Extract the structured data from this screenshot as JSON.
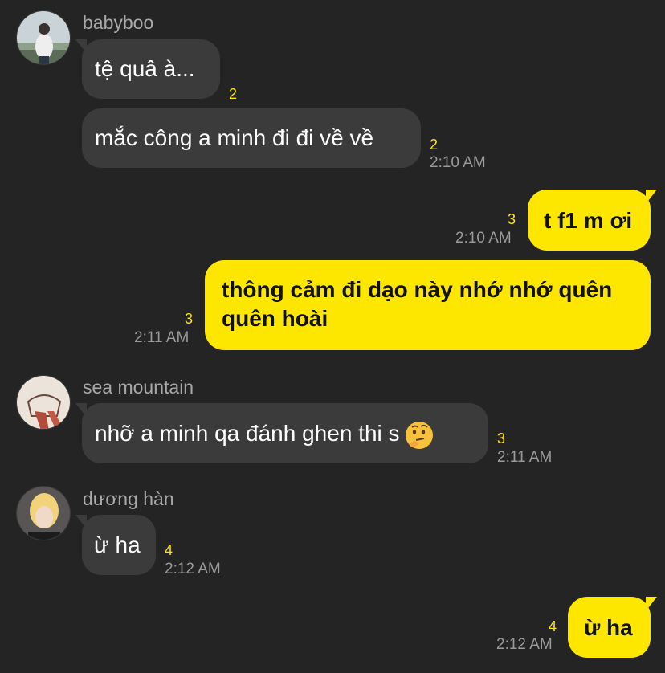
{
  "messages": [
    {
      "sender": "babyboo",
      "text": "tệ quâ à...",
      "unread": "2",
      "time": ""
    },
    {
      "sender": "",
      "text": "mắc công a minh đi đi về về",
      "unread": "2",
      "time": "2:10 AM"
    },
    {
      "sender": "me",
      "text": "t f1 m ơi",
      "unread": "3",
      "time": "2:10 AM"
    },
    {
      "sender": "me",
      "text_line1": "thông cảm đi dạo này nhớ nhớ quên",
      "text_line2": "quên hoài",
      "unread": "3",
      "time": "2:11 AM"
    },
    {
      "sender": "sea mountain",
      "text": "nhỡ a minh qa đánh ghen thi s",
      "emoji": "thinking-face",
      "unread": "3",
      "time": "2:11 AM"
    },
    {
      "sender": "dương hàn",
      "text": "ừ ha",
      "unread": "4",
      "time": "2:12 AM"
    },
    {
      "sender": "me",
      "text": "ừ ha",
      "unread": "4",
      "time": "2:12 AM"
    }
  ],
  "colors": {
    "background": "#242424",
    "incoming_bubble": "#3b3b3b",
    "outgoing_bubble": "#fde600",
    "unread": "#fde600",
    "timestamp": "#9a9a9a"
  }
}
